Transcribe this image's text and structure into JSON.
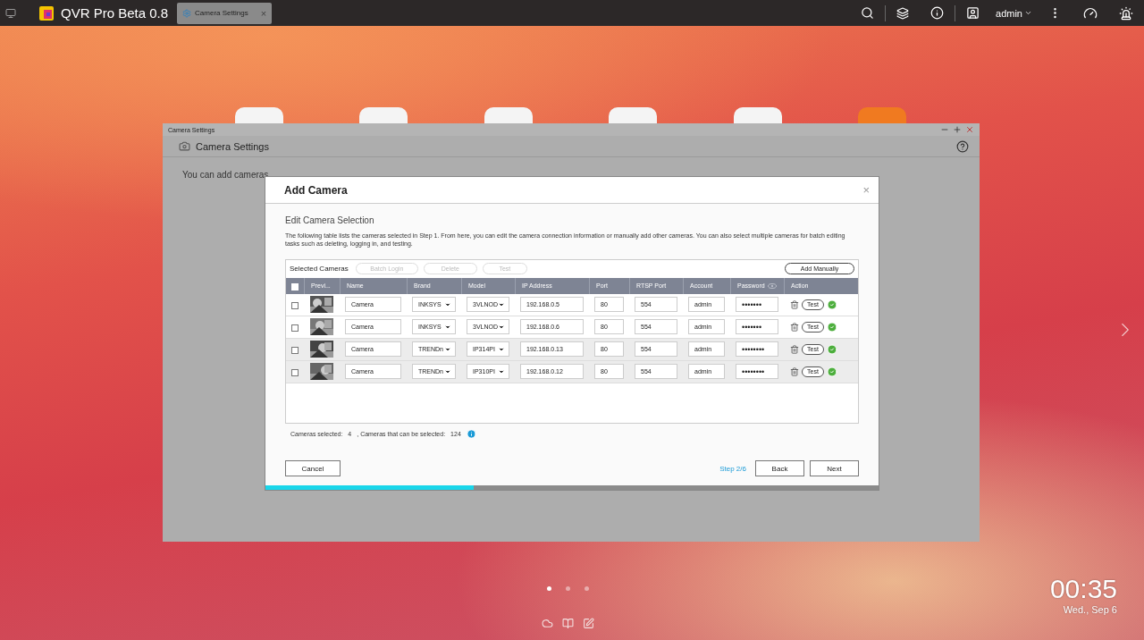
{
  "topbar": {
    "app_title": "QVR Pro Beta 0.8",
    "tabs": [
      {
        "label": "Camera Settings",
        "selected": true,
        "close": "×"
      }
    ],
    "user": "admin"
  },
  "desktop": {
    "page_dots": [
      {
        "selected": true
      },
      {
        "selected": false
      },
      {
        "selected": false
      }
    ],
    "clock": {
      "time": "00:35",
      "date": "Wed., Sep 6"
    }
  },
  "window": {
    "title": "Camera Settings",
    "header": "Camera Settings",
    "intro": "You can add cameras"
  },
  "dialog": {
    "title": "Add Camera",
    "close": "×",
    "section_title": "Edit Camera Selection",
    "description": "The following table lists the cameras selected in Step 1. From here, you can edit the camera connection information or manually add other cameras. You can also select multiple cameras for batch editing tasks such as deleting, logging in, and testing.",
    "table": {
      "title": "Selected Cameras",
      "toolbar": [
        {
          "label": "Batch Login",
          "disabled": true
        },
        {
          "label": "Delete",
          "disabled": true
        },
        {
          "label": "Test",
          "disabled": true
        }
      ],
      "add_button": "Add Manually",
      "header_checked": false,
      "columns": [
        "Previ...",
        "Name",
        "Brand",
        "Model",
        "IP Address",
        "Port",
        "RTSP Port",
        "Account",
        "Password",
        "Action"
      ],
      "rows": [
        {
          "checked": false,
          "highlighted": false,
          "name": "Camera",
          "brand": "INKSYS",
          "model": "3VLNOD",
          "ip": "192.168.0.5",
          "port": "80",
          "rtsp_port": "554",
          "account": "admin",
          "password": "•••••••",
          "test": "Test"
        },
        {
          "checked": false,
          "highlighted": false,
          "name": "Camera",
          "brand": "INKSYS",
          "model": "3VLNOD",
          "ip": "192.168.0.6",
          "port": "80",
          "rtsp_port": "554",
          "account": "admin",
          "password": "•••••••",
          "test": "Test"
        },
        {
          "checked": false,
          "highlighted": true,
          "name": "Camera",
          "brand": "TRENDn",
          "model": "IP314PI",
          "ip": "192.168.0.13",
          "port": "80",
          "rtsp_port": "554",
          "account": "admin",
          "password": "••••••••",
          "test": "Test"
        },
        {
          "checked": false,
          "highlighted": true,
          "name": "Camera",
          "brand": "TRENDn",
          "model": "IP310PI",
          "ip": "192.168.0.12",
          "port": "80",
          "rtsp_port": "554",
          "account": "admin",
          "password": "••••••••",
          "test": "Test"
        }
      ]
    },
    "summary": {
      "selected_label": "Cameras selected:",
      "selected_count": "4",
      "available_label": ", Cameras that can be selected:",
      "available_count": "124"
    },
    "cancel": "Cancel",
    "step": "Step 2/6",
    "back": "Back",
    "next": "Next",
    "progress": {
      "level": 0.34
    }
  }
}
